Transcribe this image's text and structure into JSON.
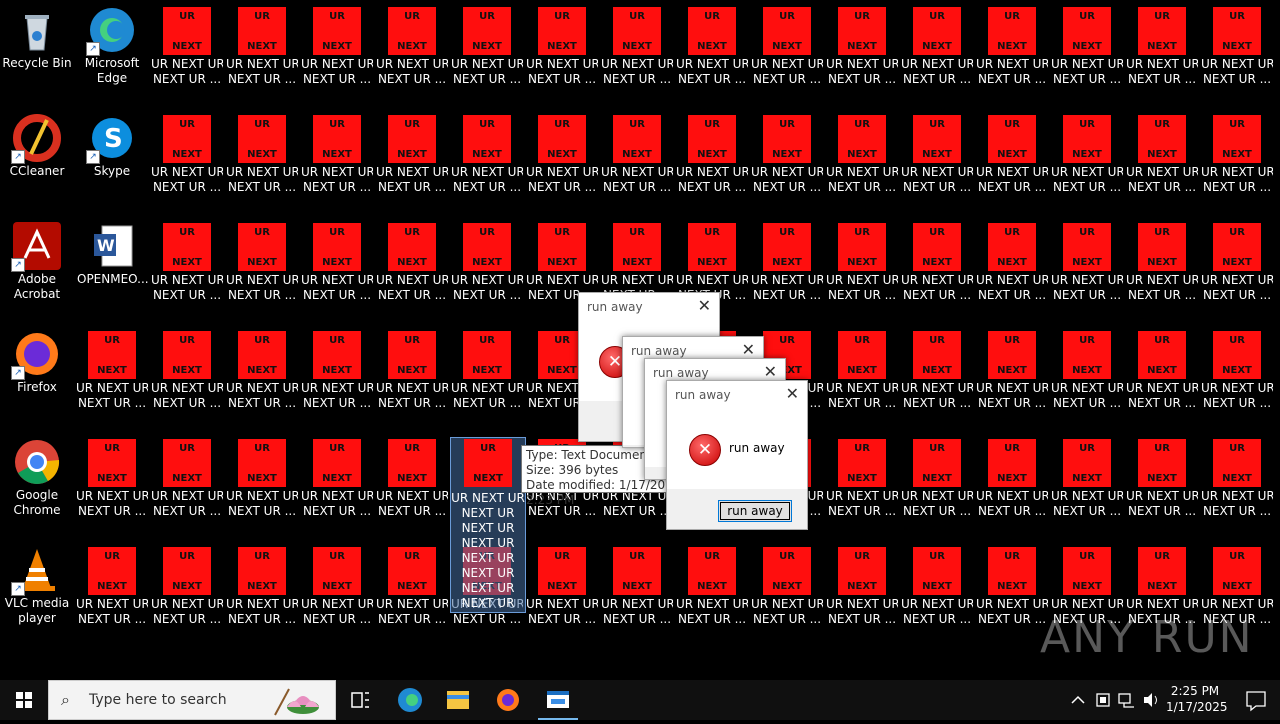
{
  "desktop_icons": [
    {
      "name": "recycle-bin",
      "label": "Recycle Bin"
    },
    {
      "name": "microsoft-edge",
      "label": "Microsoft Edge"
    },
    {
      "name": "ccleaner",
      "label": "CCleaner"
    },
    {
      "name": "skype",
      "label": "Skype"
    },
    {
      "name": "adobe-acrobat",
      "label": "Adobe Acrobat"
    },
    {
      "name": "openmeo",
      "label": "OPENMEO..."
    },
    {
      "name": "firefox",
      "label": "Firefox"
    },
    {
      "name": "google-chrome",
      "label": "Google Chrome"
    },
    {
      "name": "vlc",
      "label": "VLC media player"
    }
  ],
  "ur_file": {
    "icon_top": "UR",
    "icon_bottom": "NEXT",
    "label_line1": "UR NEXT UR",
    "label_line2": "NEXT UR ..."
  },
  "selected_file": {
    "lines": [
      "UR NEXT UR",
      "NEXT UR",
      "NEXT UR",
      "NEXT UR",
      "NEXT UR",
      "NEXT UR",
      "NEXT UR",
      "NEXT UR"
    ]
  },
  "tooltip": {
    "type": "Type: Text Document",
    "size": "Size: 396 bytes",
    "modified": "Date modified: 1/17/2025 2:23 PM"
  },
  "dialogs": {
    "title": "run away",
    "message": "run away",
    "button": "run away"
  },
  "taskbar": {
    "search_placeholder": "Type here to search",
    "time": "2:25 PM",
    "date": "1/17/2025"
  },
  "watermark": "ANY RUN",
  "colors": {
    "ur_red": "#ff0e0e",
    "accent": "#0078d7"
  }
}
